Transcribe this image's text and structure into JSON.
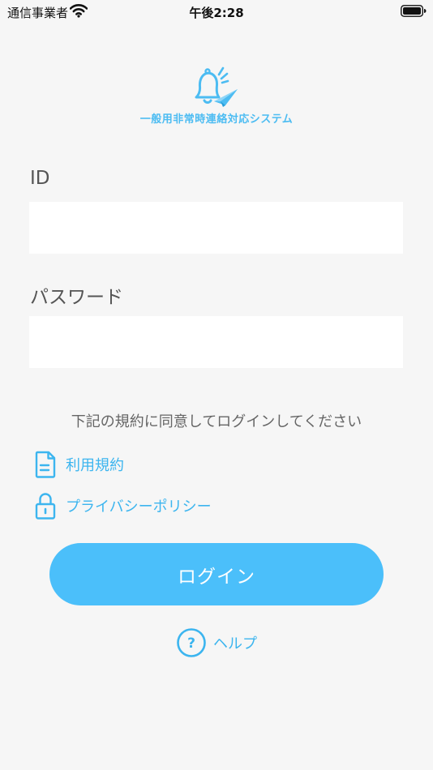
{
  "status_bar": {
    "carrier": "通信事業者",
    "time": "午後2:28"
  },
  "logo": {
    "title": "一般用非常時連絡対応システム"
  },
  "form": {
    "id_label": "ID",
    "id_value": "",
    "password_label": "パスワード",
    "password_value": ""
  },
  "terms": {
    "note": "下記の規約に同意してログインしてください",
    "links": [
      {
        "label": "利用規約",
        "icon": "document-icon"
      },
      {
        "label": "プライバシーポリシー",
        "icon": "lock-icon"
      }
    ]
  },
  "login_button": {
    "label": "ログイン"
  },
  "help": {
    "label": "ヘルプ",
    "icon": "question-circle-icon"
  },
  "colors": {
    "accent": "#4bbffa",
    "link": "#3cb5ef",
    "background": "#f6f6f6"
  }
}
